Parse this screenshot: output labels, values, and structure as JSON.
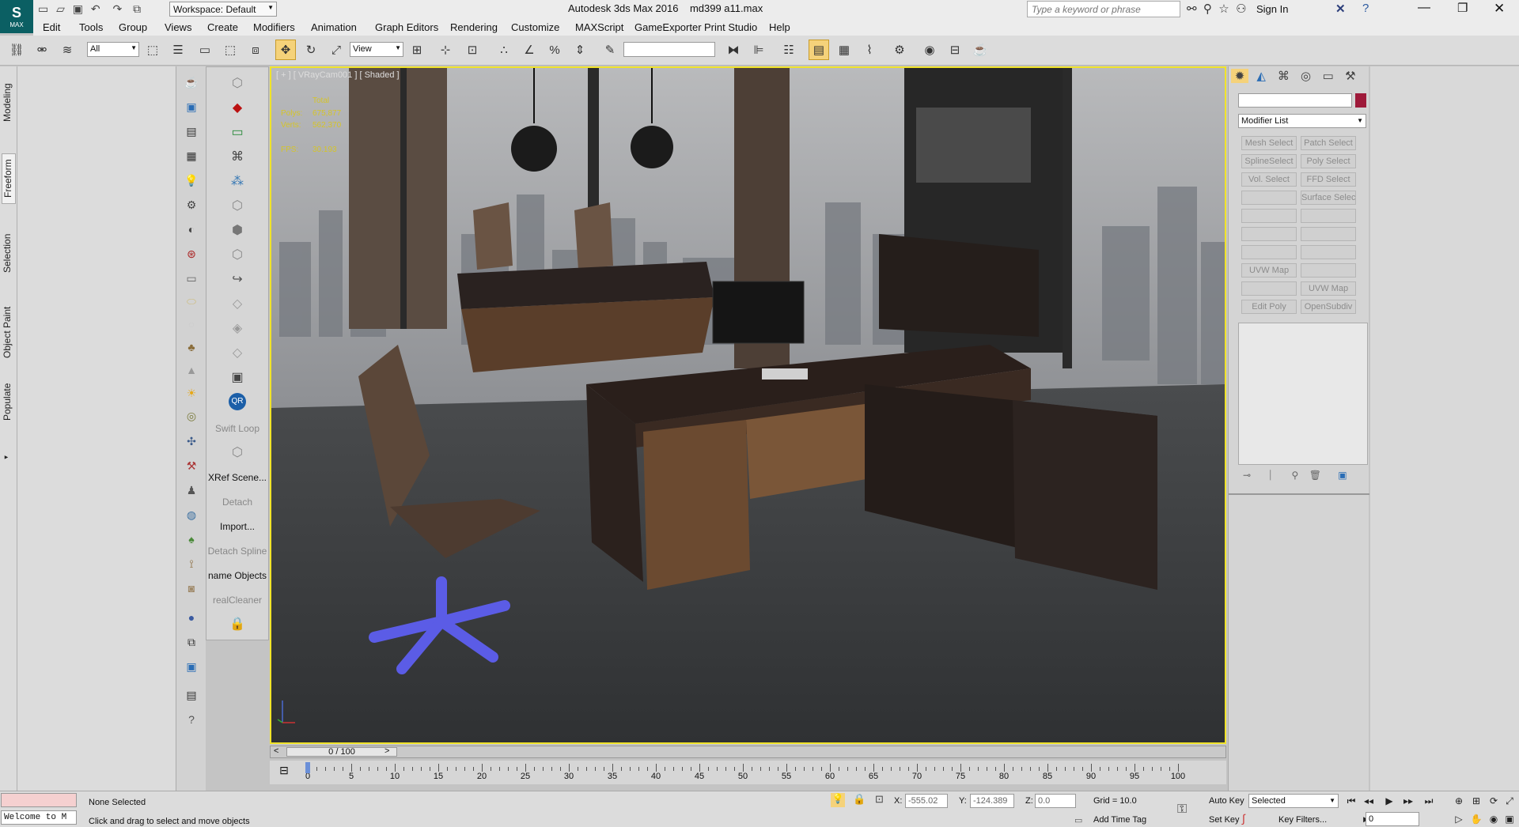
{
  "window": {
    "title": "Autodesk 3ds Max 2016",
    "filename": "md399 a11.max",
    "workspace": "Workspace: Default",
    "search_placeholder": "Type a keyword or phrase",
    "sign_in": "Sign In"
  },
  "app_logo": {
    "text": "MAX"
  },
  "menu": [
    "Edit",
    "Tools",
    "Group",
    "Views",
    "Create",
    "Modifiers",
    "Animation",
    "Graph Editors",
    "Rendering",
    "Customize",
    "MAXScript",
    "GameExporter",
    "Print Studio",
    "Help"
  ],
  "toolbar": {
    "selection_filter": "All",
    "ref_coord": "View",
    "named_selection": ""
  },
  "ribbon_tabs": [
    "Modeling",
    "Freeform",
    "Selection",
    "Object Paint",
    "Populate"
  ],
  "tool_labels": {
    "swift_loop": "Swift Loop",
    "xref": "XRef Scene...",
    "detach": "Detach",
    "import": "Import...",
    "detach_spline": "Detach Spline",
    "rename": "name Objects",
    "cleaner": "realCleaner",
    "qr": "QR"
  },
  "viewport": {
    "label": "[ + ] [ VRayCam001 ] [ Shaded ]",
    "stats": {
      "total": "Total",
      "polys_label": "Polys:",
      "polys": "675,877",
      "verts_label": "Verts:",
      "verts": "562,370",
      "fps_label": "FPS:",
      "fps": "30.193"
    }
  },
  "timeline": {
    "position": "0 / 100",
    "ticks": [
      "0",
      "5",
      "10",
      "15",
      "20",
      "25",
      "30",
      "35",
      "40",
      "45",
      "50",
      "55",
      "60",
      "65",
      "70",
      "75",
      "80",
      "85",
      "90",
      "95",
      "100"
    ]
  },
  "command_panel": {
    "name_field": "",
    "object_color": "#9e1a3a",
    "modifier_list": "Modifier List",
    "buttons": [
      "Mesh Select",
      "Patch Select",
      "SplineSelect",
      "Poly Select",
      "Vol. Select",
      "FFD Select",
      "",
      "Surface Select",
      "",
      "",
      "",
      "",
      "",
      "",
      "UVW Map",
      "",
      "",
      "UVW Map",
      "Edit Poly",
      "OpenSubdiv"
    ]
  },
  "status": {
    "maxscript": "Welcome to M",
    "selection": "None Selected",
    "prompt": "Click and drag to select and move objects",
    "x_label": "X:",
    "x": "-555.02",
    "y_label": "Y:",
    "y": "-124.389",
    "z_label": "Z:",
    "z": "0.0",
    "grid": "Grid = 10.0",
    "add_time_tag": "Add Time Tag",
    "auto_key": "Auto Key",
    "set_key": "Set Key",
    "key_mode": "Selected",
    "key_filters": "Key Filters...",
    "frame": "0"
  },
  "colors": {
    "viewport_border": "#f0e32a",
    "stat_text": "#d5c429",
    "chair_base": "#5b5ce6"
  }
}
